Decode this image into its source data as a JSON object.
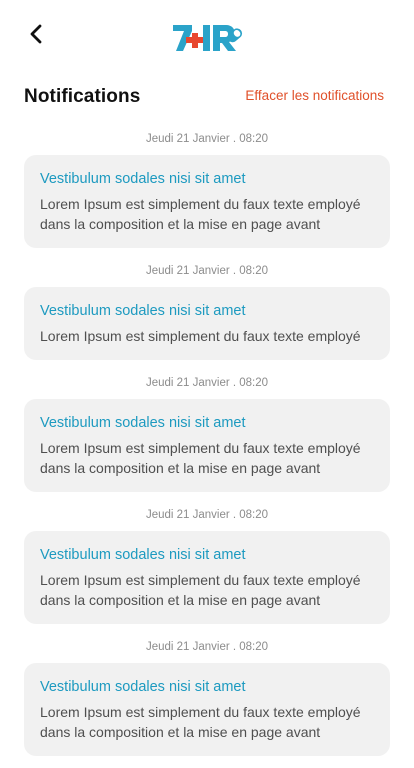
{
  "header": {
    "back_icon": "chevron-left-icon",
    "logo_text": "7+IR",
    "logo_colors": {
      "blue": "#2ba3c9",
      "red": "#e8472f"
    }
  },
  "page": {
    "title": "Notifications",
    "clear_label": "Effacer les notifications"
  },
  "notifications": [
    {
      "timestamp": "Jeudi 21 Janvier . 08:20",
      "title": "Vestibulum sodales nisi sit amet",
      "body": "Lorem Ipsum est simplement du faux texte employé dans la composition et la mise en page avant"
    },
    {
      "timestamp": "Jeudi 21 Janvier . 08:20",
      "title": "Vestibulum sodales nisi sit amet",
      "body": "Lorem Ipsum est simplement du faux texte employé"
    },
    {
      "timestamp": "Jeudi 21 Janvier . 08:20",
      "title": "Vestibulum sodales nisi sit amet",
      "body": "Lorem Ipsum est simplement du faux texte employé dans la composition et la mise en page avant"
    },
    {
      "timestamp": "Jeudi 21 Janvier . 08:20",
      "title": "Vestibulum sodales nisi sit amet",
      "body": "Lorem Ipsum est simplement du faux texte employé dans la composition et la mise en page avant"
    },
    {
      "timestamp": "Jeudi 21 Janvier . 08:20",
      "title": "Vestibulum sodales nisi sit amet",
      "body": "Lorem Ipsum est simplement du faux texte employé dans la composition et la mise en page avant"
    }
  ]
}
